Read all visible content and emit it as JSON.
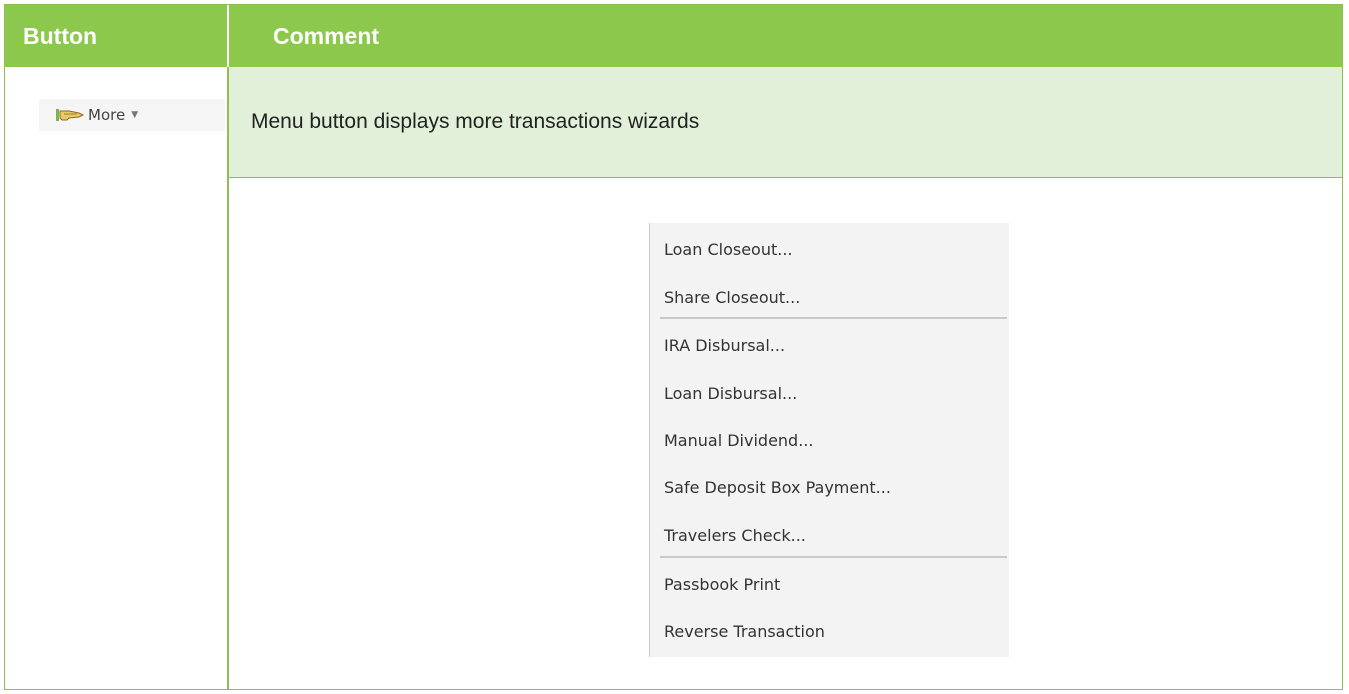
{
  "table": {
    "headers": {
      "button": "Button",
      "comment": "Comment"
    },
    "row1": {
      "button_label": "More",
      "button_icon": "hand-pointer-icon",
      "comment": "Menu button displays more transactions wizards"
    }
  },
  "menu": {
    "group1": [
      "Loan Closeout...",
      "Share Closeout..."
    ],
    "group2": [
      "IRA Disbursal...",
      "Loan Disbursal...",
      "Manual Dividend...",
      "Safe Deposit Box Payment...",
      "Travelers Check..."
    ],
    "group3": [
      "Passbook Print",
      "Reverse Transaction"
    ]
  },
  "colors": {
    "header_green": "#8cc84b",
    "row_green": "#e2efd9",
    "border_green": "#8cc152"
  }
}
